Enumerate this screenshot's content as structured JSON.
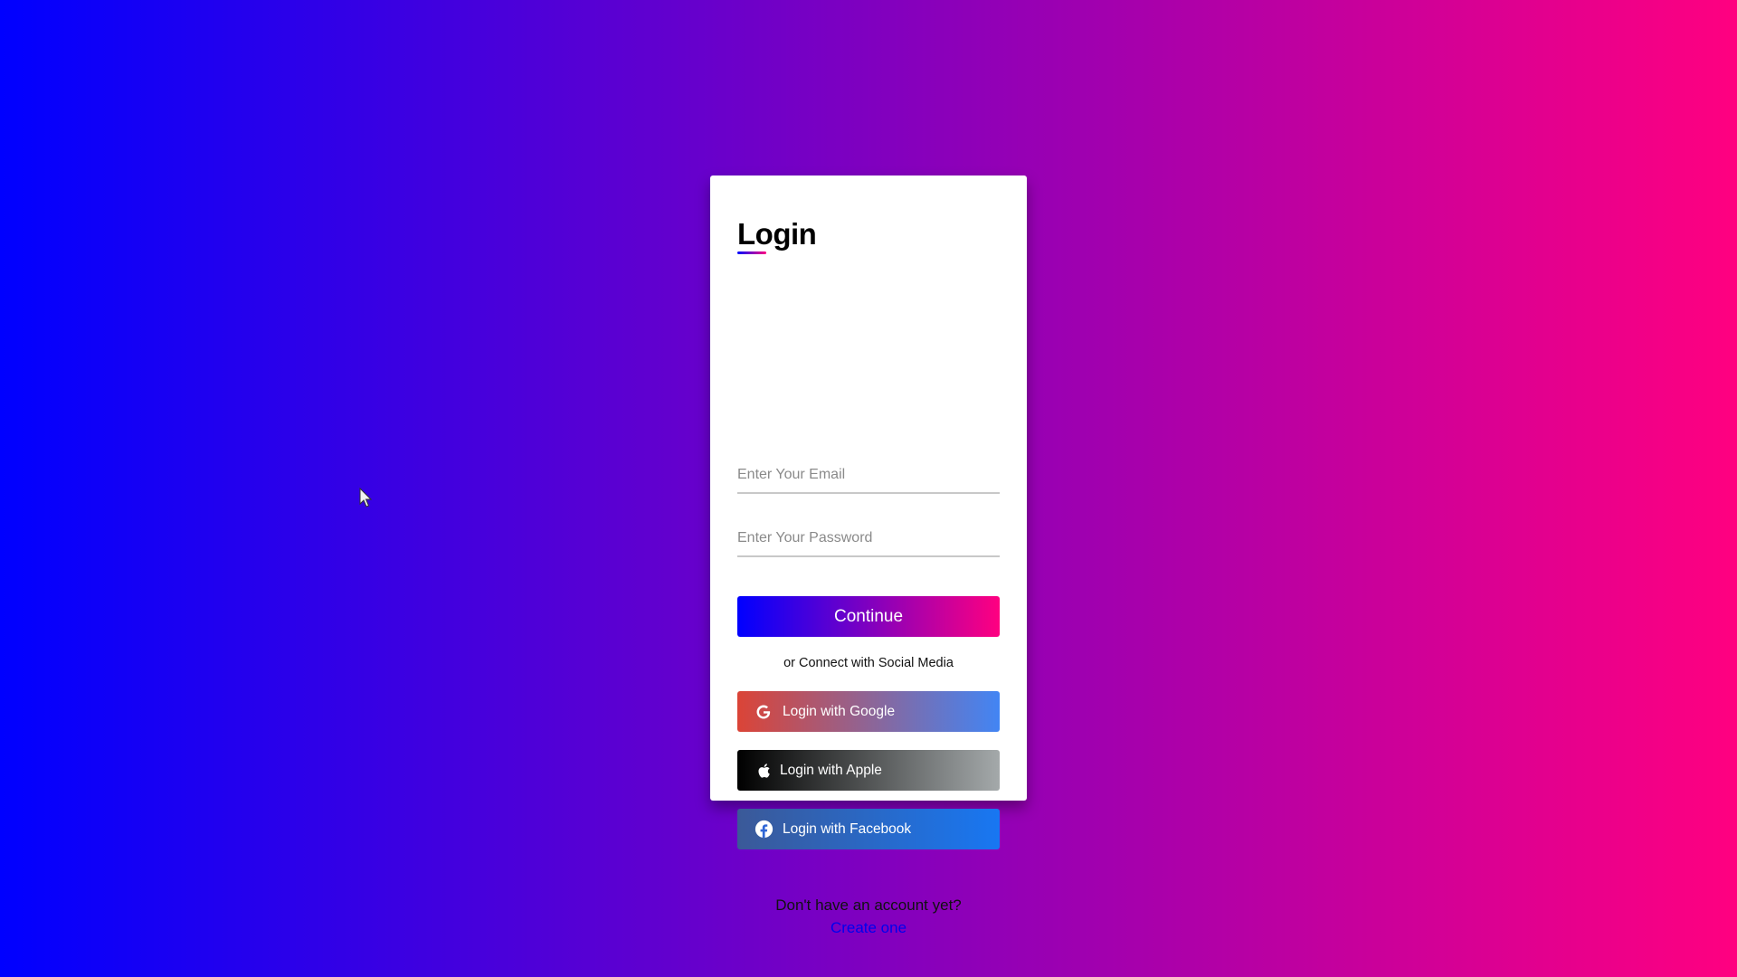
{
  "login_card": {
    "title": "Login",
    "email_placeholder": "Enter Your Email",
    "password_placeholder": "Enter Your Password",
    "continue_label": "Continue",
    "social_caption": "or Connect with Social Media",
    "social_buttons": [
      {
        "label": "Login with Google",
        "icon": "google-icon"
      },
      {
        "label": "Login with Apple",
        "icon": "apple-icon"
      },
      {
        "label": "Login with Facebook",
        "icon": "facebook-icon"
      }
    ],
    "signup_prompt": "Don't have an account yet?",
    "signup_link": "Create one"
  },
  "colors": {
    "gradient_start": "#0000ff",
    "gradient_end": "#ff0080",
    "google_start": "#db4437",
    "google_end": "#4285f4",
    "apple_start": "#000000",
    "apple_end": "#a4a9aa",
    "facebook_start": "#3b5998",
    "facebook_end": "#1877f2",
    "link": "#0000ee"
  }
}
